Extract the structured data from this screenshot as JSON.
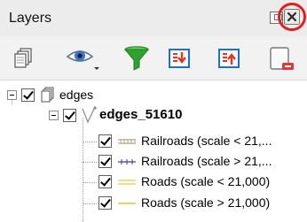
{
  "panel": {
    "title": "Layers"
  },
  "toolbar": {
    "buttons": [
      {
        "name": "add-group-icon"
      },
      {
        "name": "manage-visibility-icon"
      },
      {
        "name": "filter-legend-icon"
      },
      {
        "name": "expand-all-icon"
      },
      {
        "name": "collapse-all-icon"
      },
      {
        "name": "remove-layer-icon"
      }
    ]
  },
  "tree": {
    "group": {
      "label": "edges",
      "checked": true
    },
    "layer": {
      "label": "edges_51610",
      "checked": true
    },
    "rules": [
      {
        "label": "Railroads (scale < 21,...",
        "symbol": "railroad-solid",
        "color": "#b4a98a"
      },
      {
        "label": "Railroads (scale > 21,...",
        "symbol": "railroad-cross",
        "color": "#4a3a8a"
      },
      {
        "label": "Roads (scale < 21,000)",
        "symbol": "road-double",
        "color": "#e6d36a"
      },
      {
        "label": "Roads (scale > 21,000)",
        "symbol": "road-single",
        "color": "#e6d36a"
      }
    ]
  },
  "colors": {
    "highlight_ring": "#e0201e",
    "filter_green": "#2fa12f",
    "expand_red": "#e2361e",
    "expand_blue": "#1d6fd6"
  }
}
